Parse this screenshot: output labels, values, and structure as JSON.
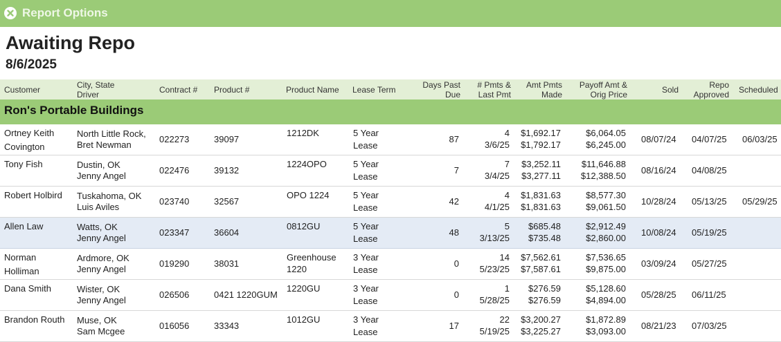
{
  "topbar": {
    "label": "Report Options"
  },
  "report": {
    "title": "Awaiting Repo",
    "date": "8/6/2025"
  },
  "columns": {
    "customer": "Customer",
    "city_state": "City, State",
    "driver": "Driver",
    "contract": "Contract #",
    "product": "Product #",
    "product_name": "Product Name",
    "lease_term": "Lease Term",
    "days_past_1": "Days Past",
    "days_past_2": "Due",
    "pmts_1": "# Pmts &",
    "pmts_2": "Last Pmt",
    "amt_1": "Amt Pmts",
    "amt_2": "Made",
    "payoff_1": "Payoff Amt &",
    "payoff_2": "Orig Price",
    "sold": "Sold",
    "repo_1": "Repo",
    "repo_2": "Approved",
    "scheduled": "Scheduled"
  },
  "group": {
    "title": "Ron's Portable Buildings"
  },
  "rows": [
    {
      "customer_1": "Ortney Keith",
      "customer_2": "Covington",
      "city": "North Little Rock,",
      "driver": "Bret Newman",
      "contract": "022273",
      "product": "39097",
      "product_name_1": "1212DK",
      "product_name_2": "",
      "term_1": "5 Year",
      "term_2": "Lease",
      "days": "87",
      "pmts": "4",
      "last_pmt": "3/6/25",
      "amt_1": "$1,692.17",
      "amt_2": "$1,792.17",
      "payoff": "$6,064.05",
      "orig": "$6,245.00",
      "sold": "08/07/24",
      "repo": "04/07/25",
      "scheduled": "06/03/25"
    },
    {
      "customer_1": "Tony Fish",
      "customer_2": "",
      "city": "Dustin, OK",
      "driver": "Jenny Angel",
      "contract": "022476",
      "product": "39132",
      "product_name_1": "1224OPO",
      "product_name_2": "",
      "term_1": "5 Year",
      "term_2": "Lease",
      "days": "7",
      "pmts": "7",
      "last_pmt": "3/4/25",
      "amt_1": "$3,252.11",
      "amt_2": "$3,277.11",
      "payoff": "$11,646.88",
      "orig": "$12,388.50",
      "sold": "08/16/24",
      "repo": "04/08/25",
      "scheduled": ""
    },
    {
      "customer_1": "Robert Holbird",
      "customer_2": "",
      "city": "Tuskahoma, OK",
      "driver": "Luis Aviles",
      "contract": "023740",
      "product": "32567",
      "product_name_1": "OPO 1224",
      "product_name_2": "",
      "term_1": "5 Year",
      "term_2": "Lease",
      "days": "42",
      "pmts": "4",
      "last_pmt": "4/1/25",
      "amt_1": "$1,831.63",
      "amt_2": "$1,831.63",
      "payoff": "$8,577.30",
      "orig": "$9,061.50",
      "sold": "10/28/24",
      "repo": "05/13/25",
      "scheduled": "05/29/25"
    },
    {
      "customer_1": "Allen Law",
      "customer_2": "",
      "city": "Watts, OK",
      "driver": "Jenny Angel",
      "contract": "023347",
      "product": "36604",
      "product_name_1": "0812GU",
      "product_name_2": "",
      "term_1": "5 Year",
      "term_2": "Lease",
      "days": "48",
      "pmts": "5",
      "last_pmt": "3/13/25",
      "amt_1": "$685.48",
      "amt_2": "$735.48",
      "payoff": "$2,912.49",
      "orig": "$2,860.00",
      "sold": "10/08/24",
      "repo": "05/19/25",
      "scheduled": ""
    },
    {
      "customer_1": "Norman",
      "customer_2": "Holliman",
      "city": "Ardmore, OK",
      "driver": "Jenny Angel",
      "contract": "019290",
      "product": "38031",
      "product_name_1": "Greenhouse",
      "product_name_2": "1220",
      "term_1": "3 Year",
      "term_2": "Lease",
      "days": "0",
      "pmts": "14",
      "last_pmt": "5/23/25",
      "amt_1": "$7,562.61",
      "amt_2": "$7,587.61",
      "payoff": "$7,536.65",
      "orig": "$9,875.00",
      "sold": "03/09/24",
      "repo": "05/27/25",
      "scheduled": ""
    },
    {
      "customer_1": "Dana Smith",
      "customer_2": "",
      "city": "Wister, OK",
      "driver": "Jenny Angel",
      "contract": "026506",
      "product": "0421 1220GUM",
      "product_name_1": "1220GU",
      "product_name_2": "",
      "term_1": "3 Year",
      "term_2": "Lease",
      "days": "0",
      "pmts": "1",
      "last_pmt": "5/28/25",
      "amt_1": "$276.59",
      "amt_2": "$276.59",
      "payoff": "$5,128.60",
      "orig": "$4,894.00",
      "sold": "05/28/25",
      "repo": "06/11/25",
      "scheduled": ""
    },
    {
      "customer_1": "Brandon Routh",
      "customer_2": "",
      "city": "Muse, OK",
      "driver": "Sam Mcgee",
      "contract": "016056",
      "product": "33343",
      "product_name_1": "1012GU",
      "product_name_2": "",
      "term_1": "3 Year",
      "term_2": "Lease",
      "days": "17",
      "pmts": "22",
      "last_pmt": "5/19/25",
      "amt_1": "$3,200.27",
      "amt_2": "$3,225.27",
      "payoff": "$1,872.89",
      "orig": "$3,093.00",
      "sold": "08/21/23",
      "repo": "07/03/25",
      "scheduled": ""
    }
  ]
}
